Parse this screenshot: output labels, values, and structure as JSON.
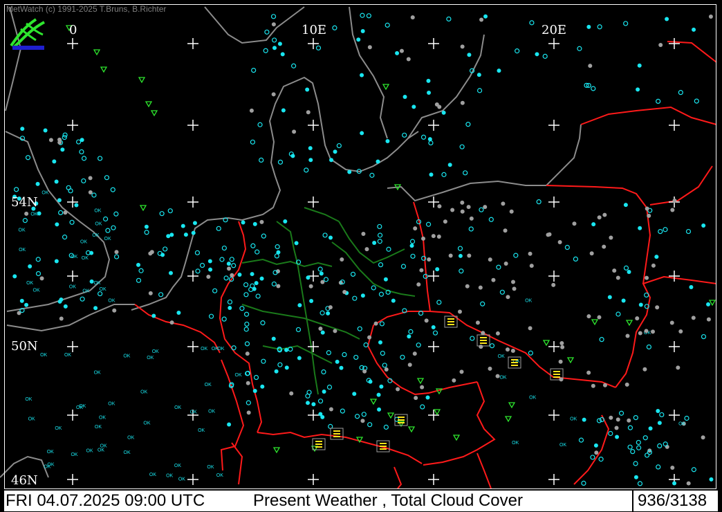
{
  "app": {
    "credit": "MetWatch (c) 1991-2025 T.Bruns, B.Richter"
  },
  "map": {
    "longitude_labels": [
      "0",
      "10E",
      "20E"
    ],
    "latitude_labels": [
      "54N",
      "50N",
      "46N"
    ],
    "colors": {
      "background": "#000000",
      "coastline": "#8c8c8c",
      "country_border": "#ff1a1a",
      "state_border": "#1a7a1a",
      "grid_cross": "#ffffff",
      "station_cloud": "#19e6f0",
      "station_gray": "#a0a0a0",
      "weather_green": "#2ee62e",
      "weather_yellow": "#ffe619"
    },
    "station_text": "OK"
  },
  "status": {
    "datetime": "FRI 04.07.2025 09:00 UTC",
    "parameters": "Present Weather    , Total Cloud Cover",
    "station_count": "936/3138"
  }
}
